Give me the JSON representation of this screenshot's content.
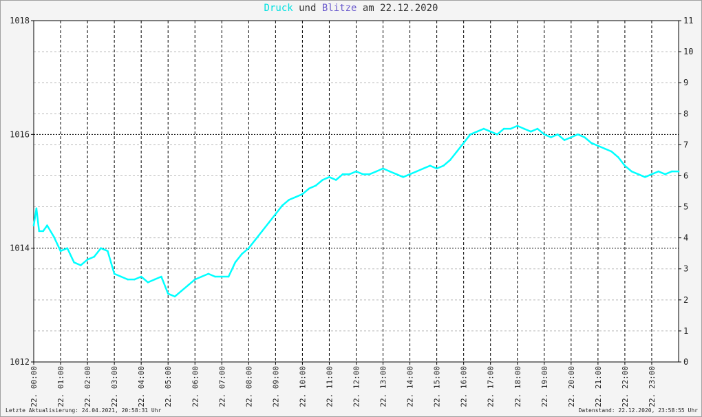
{
  "title": {
    "part1": "Druck",
    "part2": " und ",
    "part3": "Blitze",
    "part4": " am 22.12.2020"
  },
  "footer": {
    "left": "Letzte Aktualisierung: 24.04.2021, 20:58:31 Uhr",
    "right": "Datenstand: 22.12.2020, 23:58:55 Uhr"
  },
  "colors": {
    "druck": "#00ffff",
    "blitze": "#6a5acd",
    "grid_major": "#000000",
    "grid_minor": "#b8b8b8"
  },
  "chart_data": {
    "type": "line",
    "x_unit": "hour of 22.12.2020",
    "x_range": [
      0,
      24
    ],
    "x_tick_labels": [
      "22. 00:00",
      "22. 01:00",
      "22. 02:00",
      "22. 03:00",
      "22. 04:00",
      "22. 05:00",
      "22. 06:00",
      "22. 07:00",
      "22. 08:00",
      "22. 09:00",
      "22. 10:00",
      "22. 11:00",
      "22. 12:00",
      "22. 13:00",
      "22. 14:00",
      "22. 15:00",
      "22. 16:00",
      "22. 17:00",
      "22. 18:00",
      "22. 19:00",
      "22. 20:00",
      "22. 21:00",
      "22. 22:00",
      "22. 23:00"
    ],
    "y_left": {
      "ylim": [
        1012,
        1018
      ],
      "ticks": [
        1012,
        1014,
        1016,
        1018
      ]
    },
    "y_right": {
      "ylim": [
        0,
        11
      ],
      "ticks": [
        0,
        1,
        2,
        3,
        4,
        5,
        6,
        7,
        8,
        9,
        10,
        11
      ]
    },
    "grid": true,
    "series": [
      {
        "name": "Druck",
        "axis": "left",
        "x": [
          0,
          0.1,
          0.2,
          0.35,
          0.5,
          0.75,
          1.0,
          1.25,
          1.5,
          1.75,
          2.0,
          2.25,
          2.5,
          2.75,
          3.0,
          3.25,
          3.5,
          3.75,
          4.0,
          4.25,
          4.5,
          4.75,
          5.0,
          5.25,
          5.5,
          5.75,
          6.0,
          6.25,
          6.5,
          6.75,
          7.0,
          7.25,
          7.5,
          7.75,
          8.0,
          8.25,
          8.5,
          8.75,
          9.0,
          9.25,
          9.5,
          9.75,
          10.0,
          10.25,
          10.5,
          10.75,
          11.0,
          11.25,
          11.5,
          11.75,
          12.0,
          12.25,
          12.5,
          12.75,
          13.0,
          13.25,
          13.5,
          13.75,
          14.0,
          14.25,
          14.5,
          14.75,
          15.0,
          15.25,
          15.5,
          15.75,
          16.0,
          16.25,
          16.5,
          16.75,
          17.0,
          17.25,
          17.5,
          17.75,
          18.0,
          18.25,
          18.5,
          18.75,
          19.0,
          19.25,
          19.5,
          19.75,
          20.0,
          20.25,
          20.5,
          20.75,
          21.0,
          21.25,
          21.5,
          21.75,
          22.0,
          22.25,
          22.5,
          22.75,
          23.0,
          23.25,
          23.5,
          23.75,
          24.0
        ],
        "y": [
          1014.4,
          1014.7,
          1014.3,
          1014.3,
          1014.4,
          1014.2,
          1013.95,
          1014.0,
          1013.75,
          1013.7,
          1013.8,
          1013.85,
          1014.0,
          1013.95,
          1013.55,
          1013.5,
          1013.45,
          1013.45,
          1013.5,
          1013.4,
          1013.45,
          1013.5,
          1013.2,
          1013.15,
          1013.25,
          1013.35,
          1013.45,
          1013.5,
          1013.55,
          1013.5,
          1013.5,
          1013.5,
          1013.75,
          1013.9,
          1014.0,
          1014.15,
          1014.3,
          1014.45,
          1014.6,
          1014.75,
          1014.85,
          1014.9,
          1014.95,
          1015.05,
          1015.1,
          1015.2,
          1015.25,
          1015.2,
          1015.3,
          1015.3,
          1015.35,
          1015.3,
          1015.3,
          1015.35,
          1015.4,
          1015.35,
          1015.3,
          1015.25,
          1015.3,
          1015.35,
          1015.4,
          1015.45,
          1015.4,
          1015.45,
          1015.55,
          1015.7,
          1015.85,
          1016.0,
          1016.05,
          1016.1,
          1016.05,
          1016.0,
          1016.1,
          1016.1,
          1016.15,
          1016.1,
          1016.05,
          1016.1,
          1016.0,
          1015.95,
          1016.0,
          1015.9,
          1015.95,
          1016.0,
          1015.95,
          1015.85,
          1015.8,
          1015.75,
          1015.7,
          1015.6,
          1015.45,
          1015.35,
          1015.3,
          1015.25,
          1015.3,
          1015.35,
          1015.3,
          1015.35,
          1015.35
        ]
      }
    ]
  }
}
